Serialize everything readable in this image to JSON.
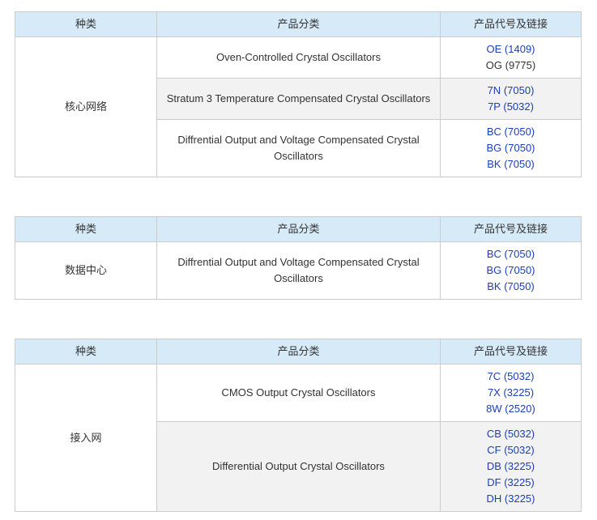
{
  "tables": [
    {
      "headers": [
        "种类",
        "产品分类",
        "产品代号及链接"
      ],
      "category": "核心网络",
      "rows": [
        {
          "product": "Oven-Controlled Crystal Oscillators",
          "links": [
            {
              "code": "OE",
              "size": "(1409)"
            }
          ],
          "plain": [
            {
              "code": "OG",
              "size": "(9775)"
            }
          ]
        },
        {
          "product": "Stratum 3 Temperature Compensated Crystal Oscillators",
          "links": [
            {
              "code": "7N",
              "size": "(7050)"
            },
            {
              "code": "7P",
              "size": "(5032)"
            }
          ]
        },
        {
          "product": "Diffrential Output and Voltage Compensated Crystal Oscillators",
          "links": [
            {
              "code": "BC",
              "size": "(7050)"
            },
            {
              "code": "BG",
              "size": "(7050)"
            },
            {
              "code": "BK",
              "size": "(7050)"
            }
          ]
        }
      ]
    },
    {
      "headers": [
        "种类",
        "产品分类",
        "产品代号及链接"
      ],
      "category": "数据中心",
      "rows": [
        {
          "product": "Diffrential Output and Voltage Compensated Crystal Oscillators",
          "links": [
            {
              "code": "BC",
              "size": "(7050)"
            },
            {
              "code": "BG",
              "size": "(7050)"
            },
            {
              "code": "BK",
              "size": "(7050)"
            }
          ]
        }
      ]
    },
    {
      "headers": [
        "种类",
        "产品分类",
        "产品代号及链接"
      ],
      "category": "接入网",
      "rows": [
        {
          "product": "CMOS Output Crystal Oscillators",
          "links": [
            {
              "code": "7C",
              "size": "(5032)"
            },
            {
              "code": "7X",
              "size": "(3225)"
            },
            {
              "code": "8W",
              "size": "(2520)"
            }
          ]
        },
        {
          "product": "Differential Output Crystal Oscillators",
          "links": [
            {
              "code": "CB",
              "size": "(5032)"
            },
            {
              "code": "CF",
              "size": "(5032)"
            },
            {
              "code": "DB",
              "size": "(3225)"
            },
            {
              "code": "DF",
              "size": "(3225)"
            },
            {
              "code": "DH",
              "size": "(3225)"
            }
          ]
        }
      ]
    }
  ],
  "colors": {
    "header_bg": "#d7eaf8",
    "link": "#1a3fb8",
    "alt_row_bg": "#f2f2f2",
    "border": "#cccccc"
  }
}
